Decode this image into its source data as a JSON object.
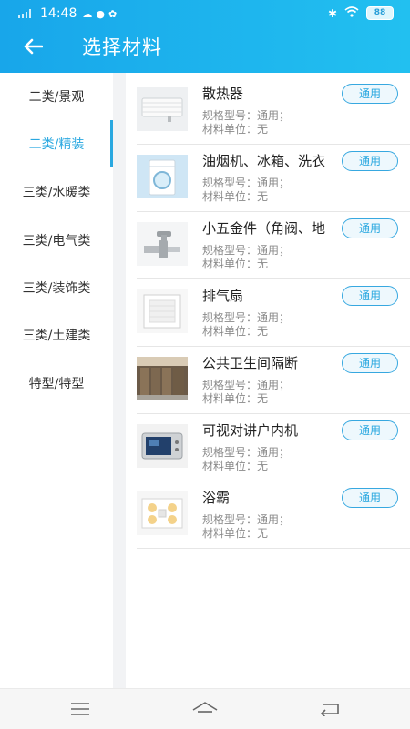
{
  "status_bar": {
    "signal": ".ıll",
    "time": "14:48",
    "app_icons": [
      "☁",
      "●",
      "✿"
    ],
    "bluetooth": "✱",
    "wifi": "≋",
    "battery": "88"
  },
  "header": {
    "title": "选择材料",
    "back_icon": "arrow-left"
  },
  "sidebar": {
    "active_index": 1,
    "items": [
      {
        "label": "二类/景观"
      },
      {
        "label": "二类/精装"
      },
      {
        "label": "三类/水暖类"
      },
      {
        "label": "三类/电气类"
      },
      {
        "label": "三类/装饰类"
      },
      {
        "label": "三类/土建类"
      },
      {
        "label": "特型/特型"
      }
    ]
  },
  "items": [
    {
      "name": "散热器",
      "spec": "规格型号：通用；",
      "unit": "材料单位：无",
      "tag": "通用",
      "thumb": "radiator"
    },
    {
      "name": "油烟机、冰箱、洗衣",
      "spec": "规格型号：通用；",
      "unit": "材料单位：无",
      "tag": "通用",
      "thumb": "washing-machine"
    },
    {
      "name": "小五金件（角阀、地",
      "spec": "规格型号：通用；",
      "unit": "材料单位：无",
      "tag": "通用",
      "thumb": "valve"
    },
    {
      "name": "排气扇",
      "spec": "规格型号：通用；",
      "unit": "材料单位：无",
      "tag": "通用",
      "thumb": "exhaust-fan"
    },
    {
      "name": "公共卫生间隔断",
      "spec": "规格型号：通用；",
      "unit": "材料单位：无",
      "tag": "通用",
      "thumb": "toilet-partition"
    },
    {
      "name": "可视对讲户内机",
      "spec": "规格型号：通用；",
      "unit": "材料单位：无",
      "tag": "通用",
      "thumb": "intercom"
    },
    {
      "name": "浴霸",
      "spec": "规格型号：通用；",
      "unit": "材料单位：无",
      "tag": "通用",
      "thumb": "bath-heater"
    }
  ],
  "nav": {
    "menu_icon": "menu",
    "home_icon": "home",
    "back_icon": "back"
  },
  "colors": {
    "accent": "#2aa8e0",
    "header_start": "#18a6ea",
    "header_end": "#22c0f0",
    "gray_text": "#8a8a8a"
  }
}
